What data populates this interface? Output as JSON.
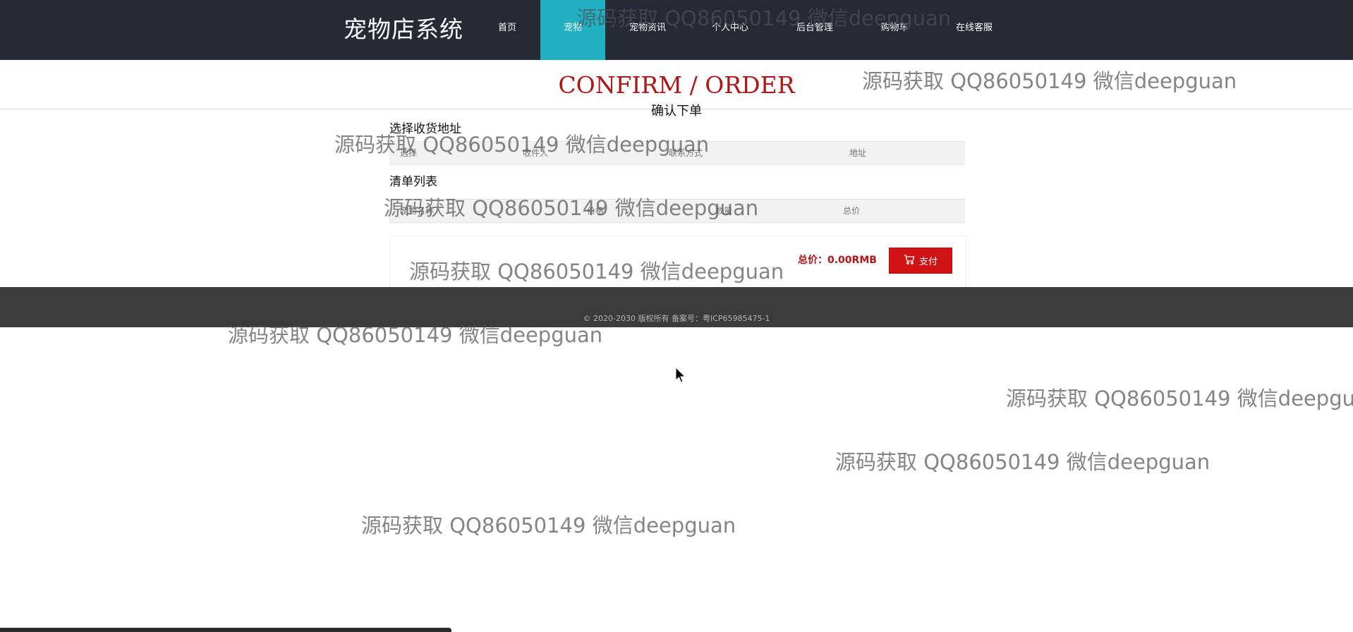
{
  "header": {
    "brand": "宠物店系统",
    "nav": [
      {
        "label": "首页",
        "active": false
      },
      {
        "label": "宠物",
        "active": true
      },
      {
        "label": "宠物资讯",
        "active": false
      },
      {
        "label": "个人中心",
        "active": false
      },
      {
        "label": "后台管理",
        "active": false
      },
      {
        "label": "购物车",
        "active": false
      },
      {
        "label": "在线客服",
        "active": false
      }
    ]
  },
  "page": {
    "title_en": "CONFIRM / ORDER",
    "title_cn": "确认下单"
  },
  "address_section": {
    "label": "选择收货地址",
    "columns": [
      "选择",
      "收件人",
      "联系方式",
      "地址"
    ]
  },
  "list_section": {
    "label": "清单列表",
    "columns": [
      "宠物名称",
      "价格",
      "数量",
      "总价"
    ]
  },
  "payment": {
    "total_text": "总价：0.00RMB",
    "pay_label": "支付",
    "pay_icon": "shopping-cart-icon"
  },
  "footer": {
    "copyright": "© 2020-2030 版权所有 备案号：粤ICP65985475-1"
  },
  "watermark": "源码获取 QQ86050149 微信deepguan",
  "colors": {
    "header_bg": "#252a34",
    "nav_active": "#1fb0c4",
    "accent_red": "#b01515",
    "pay_button": "#d01313",
    "footer_bg": "#3b3b3b"
  }
}
